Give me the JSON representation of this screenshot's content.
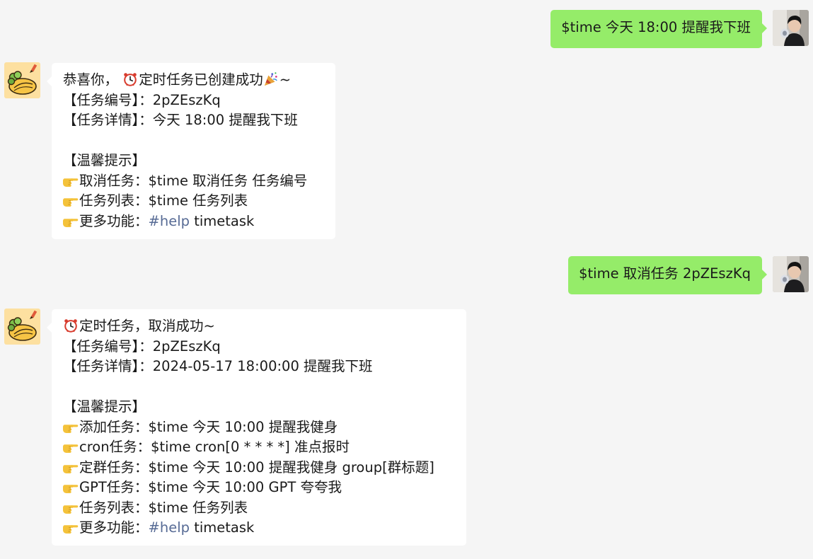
{
  "colors": {
    "background": "#f5f5f5",
    "user_bubble": "#95ec69",
    "bot_bubble": "#ffffff",
    "link": "#576b95"
  },
  "messages": [
    {
      "sender": "user",
      "text": "$time 今天 18:00 提醒我下班"
    },
    {
      "sender": "bot",
      "lines": {
        "l1_prefix": "恭喜你，",
        "l1_text": "定时任务已创建成功",
        "l1_suffix": "~",
        "l2": "【任务编号】：2pZEszKq",
        "l3": "【任务详情】：今天 18:00 提醒我下班",
        "l5": "【温馨提示】",
        "l6": "取消任务：$time 取消任务 任务编号",
        "l7": "任务列表：$time 任务列表",
        "l8_prefix": "更多功能：",
        "l8_tag": "#help",
        "l8_suffix": " timetask"
      }
    },
    {
      "sender": "user",
      "text": "$time 取消任务 2pZEszKq"
    },
    {
      "sender": "bot",
      "lines": {
        "l1_text": "定时任务，取消成功~",
        "l2": "【任务编号】：2pZEszKq",
        "l3": "【任务详情】：2024-05-17 18:00:00 提醒我下班",
        "l5": "【温馨提示】",
        "l6": "添加任务：$time 今天 10:00 提醒我健身",
        "l7": "cron任务：$time cron[0 * * * *] 准点报时",
        "l8": "定群任务：$time 今天 10:00 提醒我健身 group[群标题]",
        "l9": "GPT任务：$time 今天 10:00 GPT 夸夸我",
        "l10": "任务列表：$time 任务列表",
        "l11_prefix": "更多功能：",
        "l11_tag": "#help",
        "l11_suffix": " timetask"
      }
    }
  ],
  "icons": {
    "user_avatar": "user-photo-avatar",
    "bot_avatar": "cartoon-omelette-avatar",
    "alarm": "alarm-clock-icon",
    "party": "party-popper-icon",
    "point": "pointing-right-icon"
  }
}
